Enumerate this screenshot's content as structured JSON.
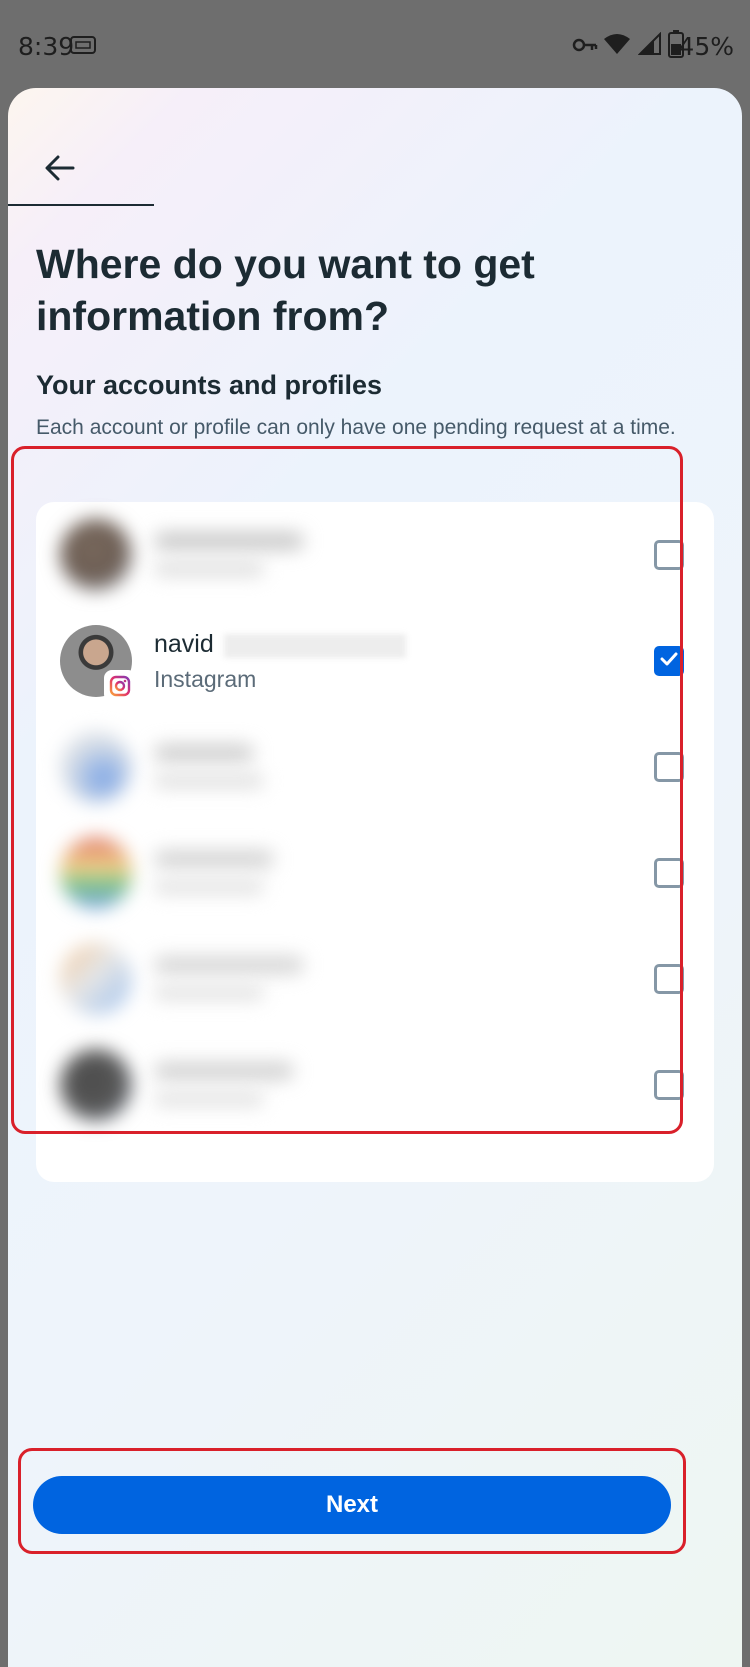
{
  "status_bar": {
    "time": "8:39",
    "battery": "45%"
  },
  "header": {
    "title": "Where do you want to get information from?"
  },
  "section": {
    "title": "Your accounts and profiles",
    "description": "Each account or profile can only have one pending request at a time."
  },
  "accounts": [
    {
      "checked": false
    },
    {
      "name": "navid",
      "platform": "Instagram",
      "checked": true
    },
    {
      "checked": false
    },
    {
      "checked": false
    },
    {
      "checked": false
    },
    {
      "checked": false
    }
  ],
  "footer": {
    "next_label": "Next"
  },
  "colors": {
    "primary": "#0064e0",
    "highlight": "#d9202a",
    "text": "#1c2b33"
  }
}
